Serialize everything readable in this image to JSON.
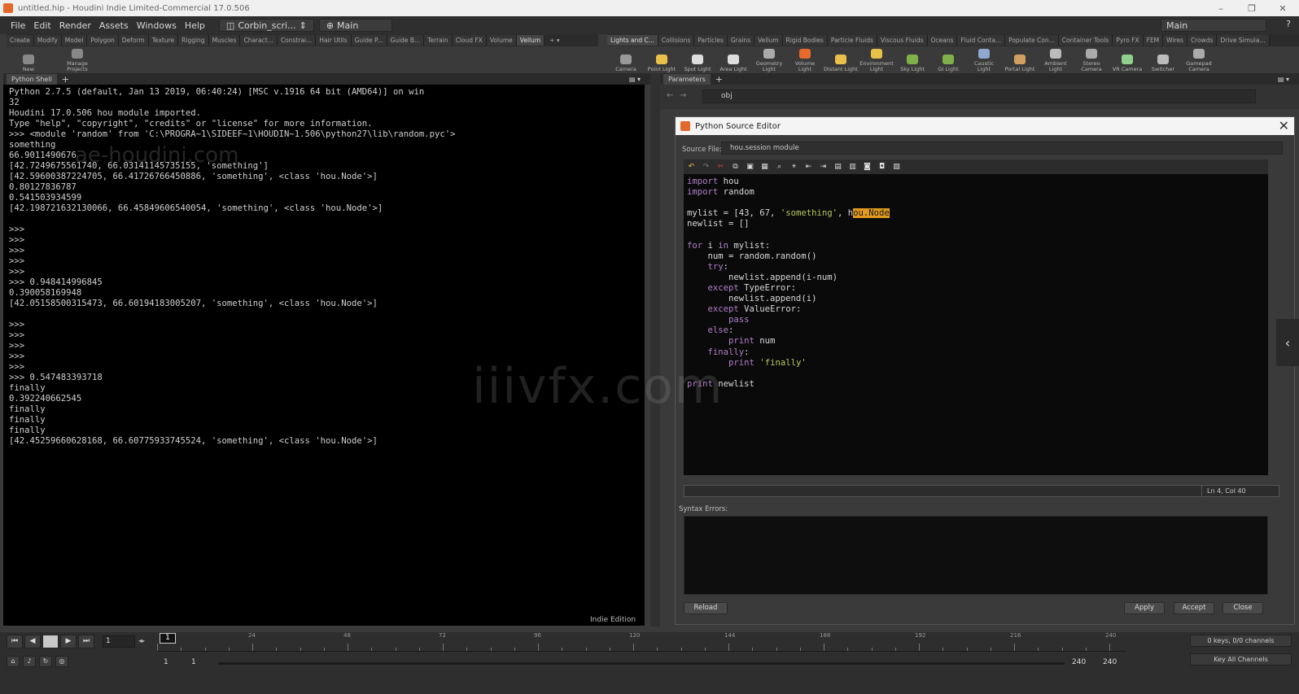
{
  "window": {
    "title": "untitled.hip - Houdini Indie Limited-Commercial 17.0.506",
    "controls": [
      "–",
      "❐",
      "✕"
    ]
  },
  "menu": {
    "items": [
      "File",
      "Edit",
      "Render",
      "Assets",
      "Windows",
      "Help"
    ],
    "desktop_tab": "Corbin_scri...",
    "main_tab": "Main",
    "right_desktop": "Main"
  },
  "shelf_tabs_left": [
    "Create",
    "Modify",
    "Model",
    "Polygon",
    "Deform",
    "Texture",
    "Rigging",
    "Muscles",
    "Charact...",
    "Constrai...",
    "Hair Utils",
    "Guide P...",
    "Guide B...",
    "Terrain",
    "Cloud FX",
    "Volume",
    "Vellum"
  ],
  "shelf_tabs_right": [
    "Lights and C...",
    "Collisions",
    "Particles",
    "Grains",
    "Vellum",
    "Rigid Bodies",
    "Particle Fluids",
    "Viscous Fluids",
    "Oceans",
    "Fluid Conta...",
    "Populate Con...",
    "Container Tools",
    "Pyro FX",
    "FEM",
    "Wires",
    "Crowds",
    "Drive Simula..."
  ],
  "shelf_tools_left": [
    "New",
    "Manage Projects"
  ],
  "shelf_tools_right": [
    "Camera",
    "Point Light",
    "Spot Light",
    "Area Light",
    "Geometry Light",
    "Volume Light",
    "Distant Light",
    "Environment Light",
    "Sky Light",
    "GI Light",
    "Caustic Light",
    "Portal Light",
    "Ambient Light",
    "Stereo Camera",
    "VR Camera",
    "Switcher",
    "Gamepad Camera"
  ],
  "python_shell": {
    "tab": "Python Shell",
    "lines": [
      "Python 2.7.5 (default, Jan 13 2019, 06:40:24) [MSC v.1916 64 bit (AMD64)] on win",
      "32",
      "Houdini 17.0.506 hou module imported.",
      "Type \"help\", \"copyright\", \"credits\" or \"license\" for more information.",
      ">>> <module 'random' from 'C:\\PROGRA~1\\SIDEEF~1\\HOUDIN~1.506\\python27\\lib\\random.pyc'>",
      "something",
      "66.9011490676",
      "[42.7249675561740, 66.03141145735155, 'something']",
      "[42.59600387224705, 66.41726766450886, 'something', <class 'hou.Node'>]",
      "0.80127836787",
      "0.541503934599",
      "[42.198721632130066, 66.45849606540054, 'something', <class 'hou.Node'>]",
      "",
      ">>>",
      ">>>",
      ">>>",
      ">>>",
      ">>>",
      ">>> 0.948414996845",
      "0.390058169948",
      "[42.05158500315473, 66.60194183005207, 'something', <class 'hou.Node'>]",
      "",
      ">>>",
      ">>>",
      ">>>",
      ">>>",
      ">>>",
      ">>> 0.547483393718",
      "finally",
      "0.392240662545",
      "finally",
      "finally",
      "finally",
      "[42.45259660628168, 66.60775933745524, 'something', <class 'hou.Node'>]"
    ],
    "edition": "Indie Edition"
  },
  "parameters": {
    "tab": "Parameters",
    "path": "obj"
  },
  "pse": {
    "title": "Python Source Editor",
    "source_label": "Source File:",
    "source_value": "hou.session module",
    "cursor": "Ln 4, Col 40",
    "syntax_label": "Syntax Errors:",
    "buttons": {
      "reload": "Reload",
      "apply": "Apply",
      "accept": "Accept",
      "close": "Close"
    },
    "code": {
      "l1a": "import",
      "l1b": " hou",
      "l2a": "import",
      "l2b": " random",
      "l4a": "mylist = [43, 67, ",
      "l4s": "'something'",
      "l4c": ", h",
      "l4sel": "ou.Node",
      "l5": "newlist = []",
      "l7a": "for",
      "l7b": " i ",
      "l7c": "in",
      "l7d": " mylist:",
      "l8": "    num = random.random()",
      "l9a": "    ",
      "l9b": "try",
      "l9c": ":",
      "l10": "        newlist.append(i-num)",
      "l11a": "    ",
      "l11b": "except",
      "l11c": " TypeError:",
      "l12": "        newlist.append(i)",
      "l13a": "    ",
      "l13b": "except",
      "l13c": " ValueError:",
      "l14a": "        ",
      "l14b": "pass",
      "l15a": "    ",
      "l15b": "else",
      "l15c": ":",
      "l16a": "        ",
      "l16b": "print",
      "l16c": " num",
      "l17a": "    ",
      "l17b": "finally",
      "l17c": ":",
      "l18a": "        ",
      "l18b": "print",
      "l18c": " ",
      "l18s": "'finally'",
      "l20a": "print",
      "l20b": " newlist"
    }
  },
  "timeline": {
    "frame": "1",
    "current": "1",
    "ticks": [
      "24",
      "48",
      "72",
      "96",
      "120",
      "144",
      "168",
      "192",
      "216",
      "240"
    ],
    "range_start_a": "1",
    "range_start_b": "1",
    "range_end_a": "240",
    "range_end_b": "240",
    "keys": "0 keys, 0/0 channels",
    "key_all": "Key All Channels"
  },
  "watermarks": {
    "main": "iiivfx.com",
    "shell": "ae-houdini.com"
  }
}
